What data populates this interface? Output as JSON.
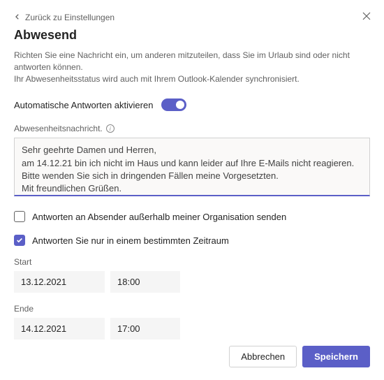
{
  "back_label": "Zurück zu Einstellungen",
  "title": "Abwesend",
  "description_line1": "Richten Sie eine Nachricht ein, um anderen mitzuteilen, dass Sie im Urlaub sind oder nicht antworten können.",
  "description_line2": "Ihr Abwesenheitsstatus wird auch mit Ihrem Outlook-Kalender synchronisiert.",
  "toggle_label": "Automatische Antworten aktivieren",
  "message_field_label": "Abwesenheitsnachricht.",
  "message_value": "Sehr geehrte Damen und Herren,\nam 14.12.21 bin ich nicht im Haus und kann leider auf Ihre E-Mails nicht reagieren.\nBitte wenden Sie sich in dringenden Fällen meine Vorgesetzten.\nMit freundlichen Grüßen.",
  "checkbox_external_label": "Antworten an Absender außerhalb meiner Organisation senden",
  "checkbox_external_checked": false,
  "checkbox_period_label": "Antworten Sie nur in einem bestimmten Zeitraum",
  "checkbox_period_checked": true,
  "start_label": "Start",
  "start_date": "13.12.2021",
  "start_time": "18:00",
  "end_label": "Ende",
  "end_date": "14.12.2021",
  "end_time": "17:00",
  "cancel_label": "Abbrechen",
  "save_label": "Speichern"
}
